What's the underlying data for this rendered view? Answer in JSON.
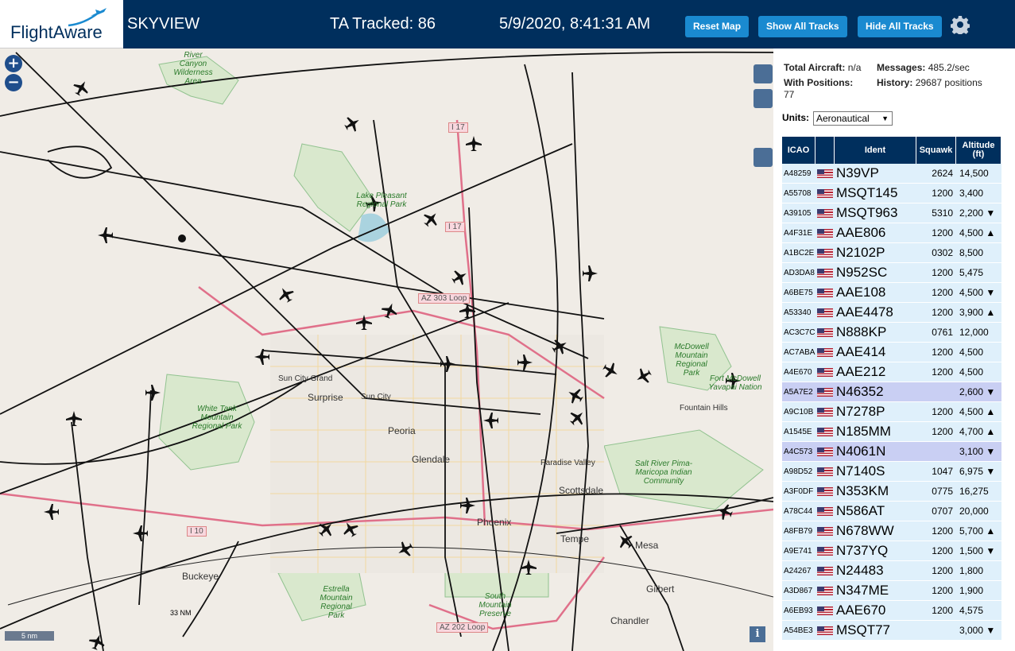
{
  "header": {
    "logo_text": "FlightAware",
    "app_title": "SKYVIEW",
    "ta_tracked": "TA Tracked: 86",
    "datetime": "5/9/2020, 8:41:31 AM",
    "reset_map": "Reset Map",
    "show_all_tracks": "Show All Tracks",
    "hide_all_tracks": "Hide All Tracks",
    "settings_icon": "gear-icon"
  },
  "map": {
    "zoom_in": "+",
    "zoom_out": "−",
    "scale": "5 nm",
    "range_ring": "33 NM",
    "info": "i",
    "places": [
      "Sun City Grand",
      "Surprise",
      "Sun City",
      "Peoria",
      "Glendale",
      "Phoenix",
      "Paradise Valley",
      "Scottsdale",
      "Tempe",
      "Mesa",
      "Gilbert",
      "Chandler",
      "Buckeye",
      "Fountain Hills"
    ],
    "parks": [
      "River Canyon Wilderness Area",
      "Lake Pleasant Regional Park",
      "White Tank Mountain Regional Park",
      "McDowell Mountain Regional Park",
      "Fort McDowell Yavapai Nation",
      "Salt River Pima-Maricopa Indian Community",
      "Estrella Mountain Regional Park",
      "South Mountain Preserve"
    ],
    "highways": [
      "I 17",
      "I 17",
      "AZ 303 Loop",
      "I 10",
      "AZ 202 Loop"
    ]
  },
  "stats": {
    "total_aircraft_label": "Total Aircraft:",
    "total_aircraft": "n/a",
    "messages_label": "Messages:",
    "messages": "485.2/sec",
    "with_positions_label": "With Positions:",
    "with_positions": "77",
    "history_label": "History:",
    "history": "29687 positions"
  },
  "units": {
    "label": "Units:",
    "value": "Aeronautical"
  },
  "table": {
    "columns": [
      "ICAO",
      "",
      "Ident",
      "Squawk",
      "Altitude (ft)"
    ],
    "rows": [
      {
        "icao": "A48259",
        "ident": "N39VP",
        "squawk": "2624",
        "alt": "14,500",
        "trend": ""
      },
      {
        "icao": "A55708",
        "ident": "MSQT145",
        "squawk": "1200",
        "alt": "3,400",
        "trend": ""
      },
      {
        "icao": "A39105",
        "ident": "MSQT963",
        "squawk": "5310",
        "alt": "2,200",
        "trend": "▼"
      },
      {
        "icao": "A4F31E",
        "ident": "AAE806",
        "squawk": "1200",
        "alt": "4,500",
        "trend": "▲"
      },
      {
        "icao": "A1BC2E",
        "ident": "N2102P",
        "squawk": "0302",
        "alt": "8,500",
        "trend": ""
      },
      {
        "icao": "AD3DA8",
        "ident": "N952SC",
        "squawk": "1200",
        "alt": "5,475",
        "trend": ""
      },
      {
        "icao": "A6BE75",
        "ident": "AAE108",
        "squawk": "1200",
        "alt": "4,500",
        "trend": "▼"
      },
      {
        "icao": "A53340",
        "ident": "AAE4478",
        "squawk": "1200",
        "alt": "3,900",
        "trend": "▲"
      },
      {
        "icao": "AC3C7C",
        "ident": "N888KP",
        "squawk": "0761",
        "alt": "12,000",
        "trend": ""
      },
      {
        "icao": "AC7ABA",
        "ident": "AAE414",
        "squawk": "1200",
        "alt": "4,500",
        "trend": ""
      },
      {
        "icao": "A4E670",
        "ident": "AAE212",
        "squawk": "1200",
        "alt": "4,500",
        "trend": ""
      },
      {
        "icao": "A5A7E2",
        "ident": "N46352",
        "squawk": "",
        "alt": "2,600",
        "trend": "▼",
        "selected": true
      },
      {
        "icao": "A9C10B",
        "ident": "N7278P",
        "squawk": "1200",
        "alt": "4,500",
        "trend": "▲"
      },
      {
        "icao": "A1545E",
        "ident": "N185MM",
        "squawk": "1200",
        "alt": "4,700",
        "trend": "▲"
      },
      {
        "icao": "A4C573",
        "ident": "N4061N",
        "squawk": "",
        "alt": "3,100",
        "trend": "▼",
        "selected": true
      },
      {
        "icao": "A98D52",
        "ident": "N7140S",
        "squawk": "1047",
        "alt": "6,975",
        "trend": "▼"
      },
      {
        "icao": "A3F0DF",
        "ident": "N353KM",
        "squawk": "0775",
        "alt": "16,275",
        "trend": ""
      },
      {
        "icao": "A78C44",
        "ident": "N586AT",
        "squawk": "0707",
        "alt": "20,000",
        "trend": ""
      },
      {
        "icao": "A8FB79",
        "ident": "N678WW",
        "squawk": "1200",
        "alt": "5,700",
        "trend": "▲"
      },
      {
        "icao": "A9E741",
        "ident": "N737YQ",
        "squawk": "1200",
        "alt": "1,500",
        "trend": "▼"
      },
      {
        "icao": "A24267",
        "ident": "N24483",
        "squawk": "1200",
        "alt": "1,800",
        "trend": ""
      },
      {
        "icao": "A3D867",
        "ident": "N347ME",
        "squawk": "1200",
        "alt": "1,900",
        "trend": ""
      },
      {
        "icao": "A6EB93",
        "ident": "AAE670",
        "squawk": "1200",
        "alt": "4,575",
        "trend": ""
      },
      {
        "icao": "A54BE3",
        "ident": "MSQT77",
        "squawk": "",
        "alt": "3,000",
        "trend": "▼"
      }
    ]
  }
}
